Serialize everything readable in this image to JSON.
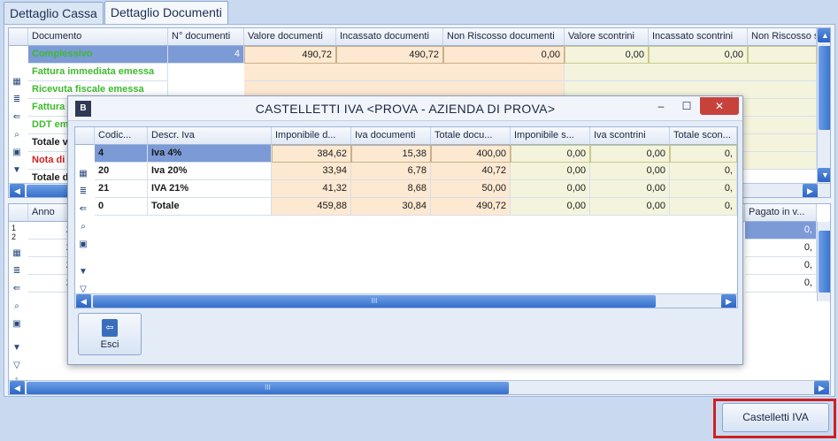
{
  "tabs": [
    {
      "label": "Dettaglio Cassa"
    },
    {
      "label": "Dettaglio Documenti"
    }
  ],
  "top_grid": {
    "columns": [
      "Documento",
      "N° documenti",
      "Valore documenti",
      "Incassato documenti",
      "Non Riscosso documenti",
      "Valore scontrini",
      "Incassato scontrini",
      "Non Riscosso so"
    ],
    "rows": [
      {
        "label": "Complessivo",
        "n": "4",
        "valore": "490,72",
        "incassato": "490,72",
        "non_riscosso": "0,00",
        "valore_s": "0,00",
        "incassato_s": "0,00"
      },
      {
        "label": "Fattura immediata emessa"
      },
      {
        "label": "Ricevuta fiscale emessa"
      },
      {
        "label": "Fattura"
      },
      {
        "label": "DDT em"
      },
      {
        "label": "Totale v"
      },
      {
        "label": "Nota di a"
      },
      {
        "label": "Totale d"
      }
    ]
  },
  "bottom_grid": {
    "columns": [
      "Anno",
      "Pagato in v..."
    ],
    "rows": [
      {
        "anno": "20",
        "pagato": "0,"
      },
      {
        "anno": "20",
        "pagato": "0,"
      },
      {
        "anno": "20",
        "pagato": "0,"
      },
      {
        "anno": "20",
        "pagato": "0,"
      }
    ],
    "row_markers": [
      "1",
      "2"
    ]
  },
  "modal": {
    "title": "CASTELLETTI IVA <PROVA - AZIENDA DI PROVA>",
    "columns": [
      "Codic...",
      "Descr. Iva",
      "Imponibile d...",
      "Iva documenti",
      "Totale docu...",
      "Imponibile s...",
      "Iva scontrini",
      "Totale scon..."
    ],
    "rows": [
      {
        "codice": "4",
        "descr": "Iva 4%",
        "imp_d": "384,62",
        "iva_d": "15,38",
        "tot_d": "400,00",
        "imp_s": "0,00",
        "iva_s": "0,00",
        "tot_s": "0,"
      },
      {
        "codice": "20",
        "descr": "Iva 20%",
        "imp_d": "33,94",
        "iva_d": "6,78",
        "tot_d": "40,72",
        "imp_s": "0,00",
        "iva_s": "0,00",
        "tot_s": "0,"
      },
      {
        "codice": "21",
        "descr": "IVA 21%",
        "imp_d": "41,32",
        "iva_d": "8,68",
        "tot_d": "50,00",
        "imp_s": "0,00",
        "iva_s": "0,00",
        "tot_s": "0,"
      },
      {
        "codice": "0",
        "descr": "Totale",
        "imp_d": "459,88",
        "iva_d": "30,84",
        "tot_d": "490,72",
        "imp_s": "0,00",
        "iva_s": "0,00",
        "tot_s": "0,"
      }
    ],
    "exit_label": "Esci",
    "scroll_grip": "III",
    "window_controls": {
      "minimize": "–",
      "maximize": "☐",
      "close": "✕"
    }
  },
  "scroll_grip": "III",
  "footer": {
    "castelletti_label": "Castelletti IVA"
  },
  "colors": {
    "green": "#3dbb2c",
    "red": "#d42020",
    "selected": "#7b9ad6",
    "peach": "#fde9d1",
    "cream": "#f4f4dc",
    "highlight": "#d02020"
  }
}
